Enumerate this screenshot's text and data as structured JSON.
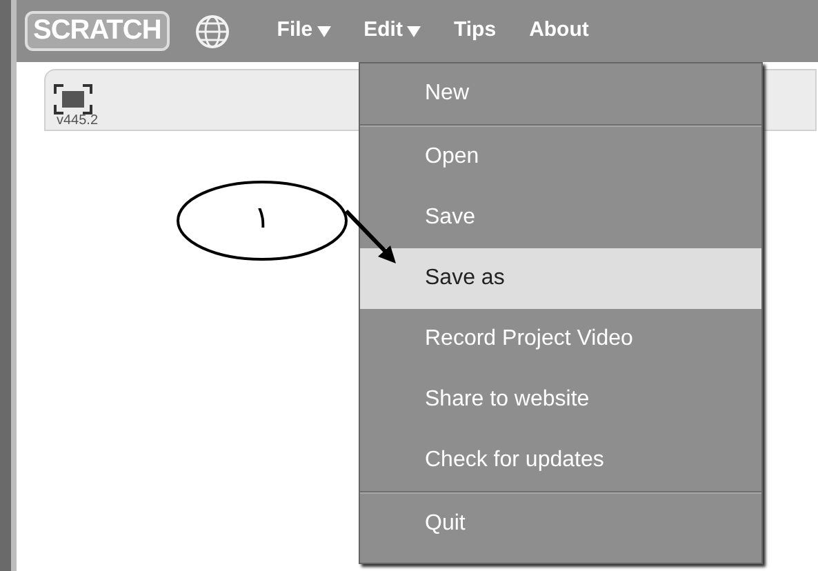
{
  "menu_bar": {
    "logo": "SCRATCH",
    "items": [
      {
        "label": "File",
        "caret": true
      },
      {
        "label": "Edit",
        "caret": true
      },
      {
        "label": "Tips",
        "caret": false
      },
      {
        "label": "About",
        "caret": false
      }
    ]
  },
  "stage_panel": {
    "version": "v445.2"
  },
  "file_menu": {
    "sections": [
      [
        {
          "label": "New",
          "selected": false
        }
      ],
      [
        {
          "label": "Open",
          "selected": false
        },
        {
          "label": "Save",
          "selected": false
        },
        {
          "label": "Save as",
          "selected": true
        },
        {
          "label": "Record Project Video",
          "selected": false
        },
        {
          "label": "Share to website",
          "selected": false
        },
        {
          "label": "Check for updates",
          "selected": false
        }
      ],
      [
        {
          "label": "Quit",
          "selected": false
        }
      ]
    ]
  },
  "callout": {
    "label": "١"
  }
}
